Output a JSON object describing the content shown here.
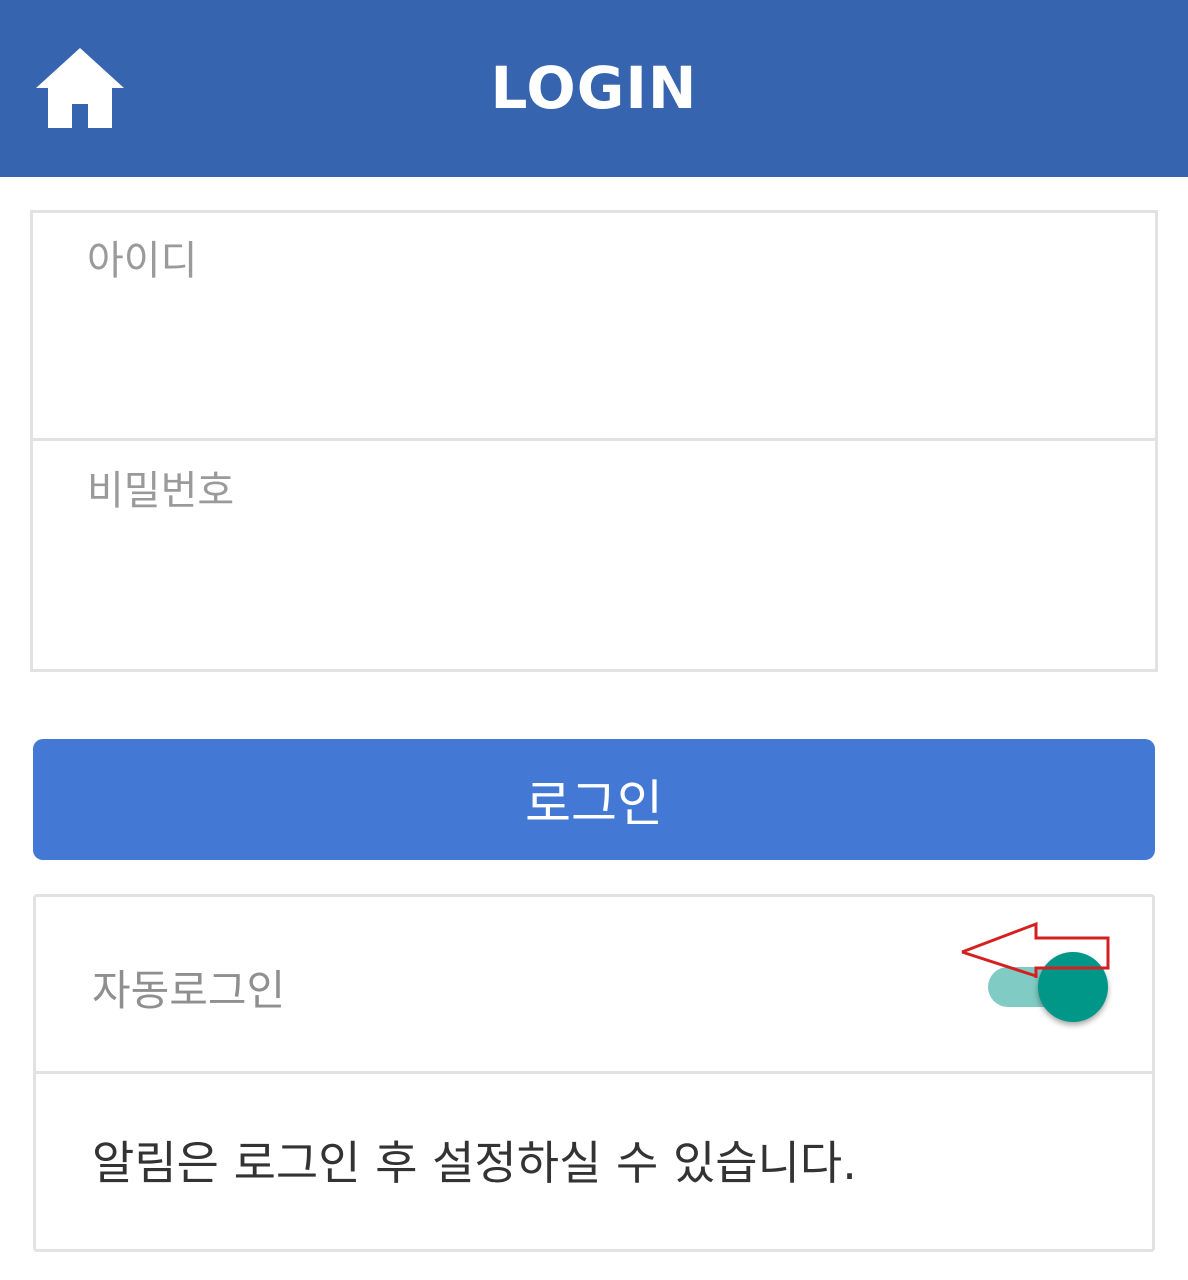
{
  "header": {
    "title": "LOGIN",
    "home_icon": "home-icon",
    "background": "#3764af"
  },
  "form": {
    "id_placeholder": "아이디",
    "password_placeholder": "비밀번호"
  },
  "login_button": {
    "label": "로그인",
    "color": "#4379d4"
  },
  "auto_login": {
    "label": "자동로그인",
    "toggle_on": true,
    "toggle_color": "#009688",
    "annotation_icon": "red-arrow-icon"
  },
  "notice": {
    "text": "알림은 로그인 후 설정하실 수 있습니다."
  }
}
